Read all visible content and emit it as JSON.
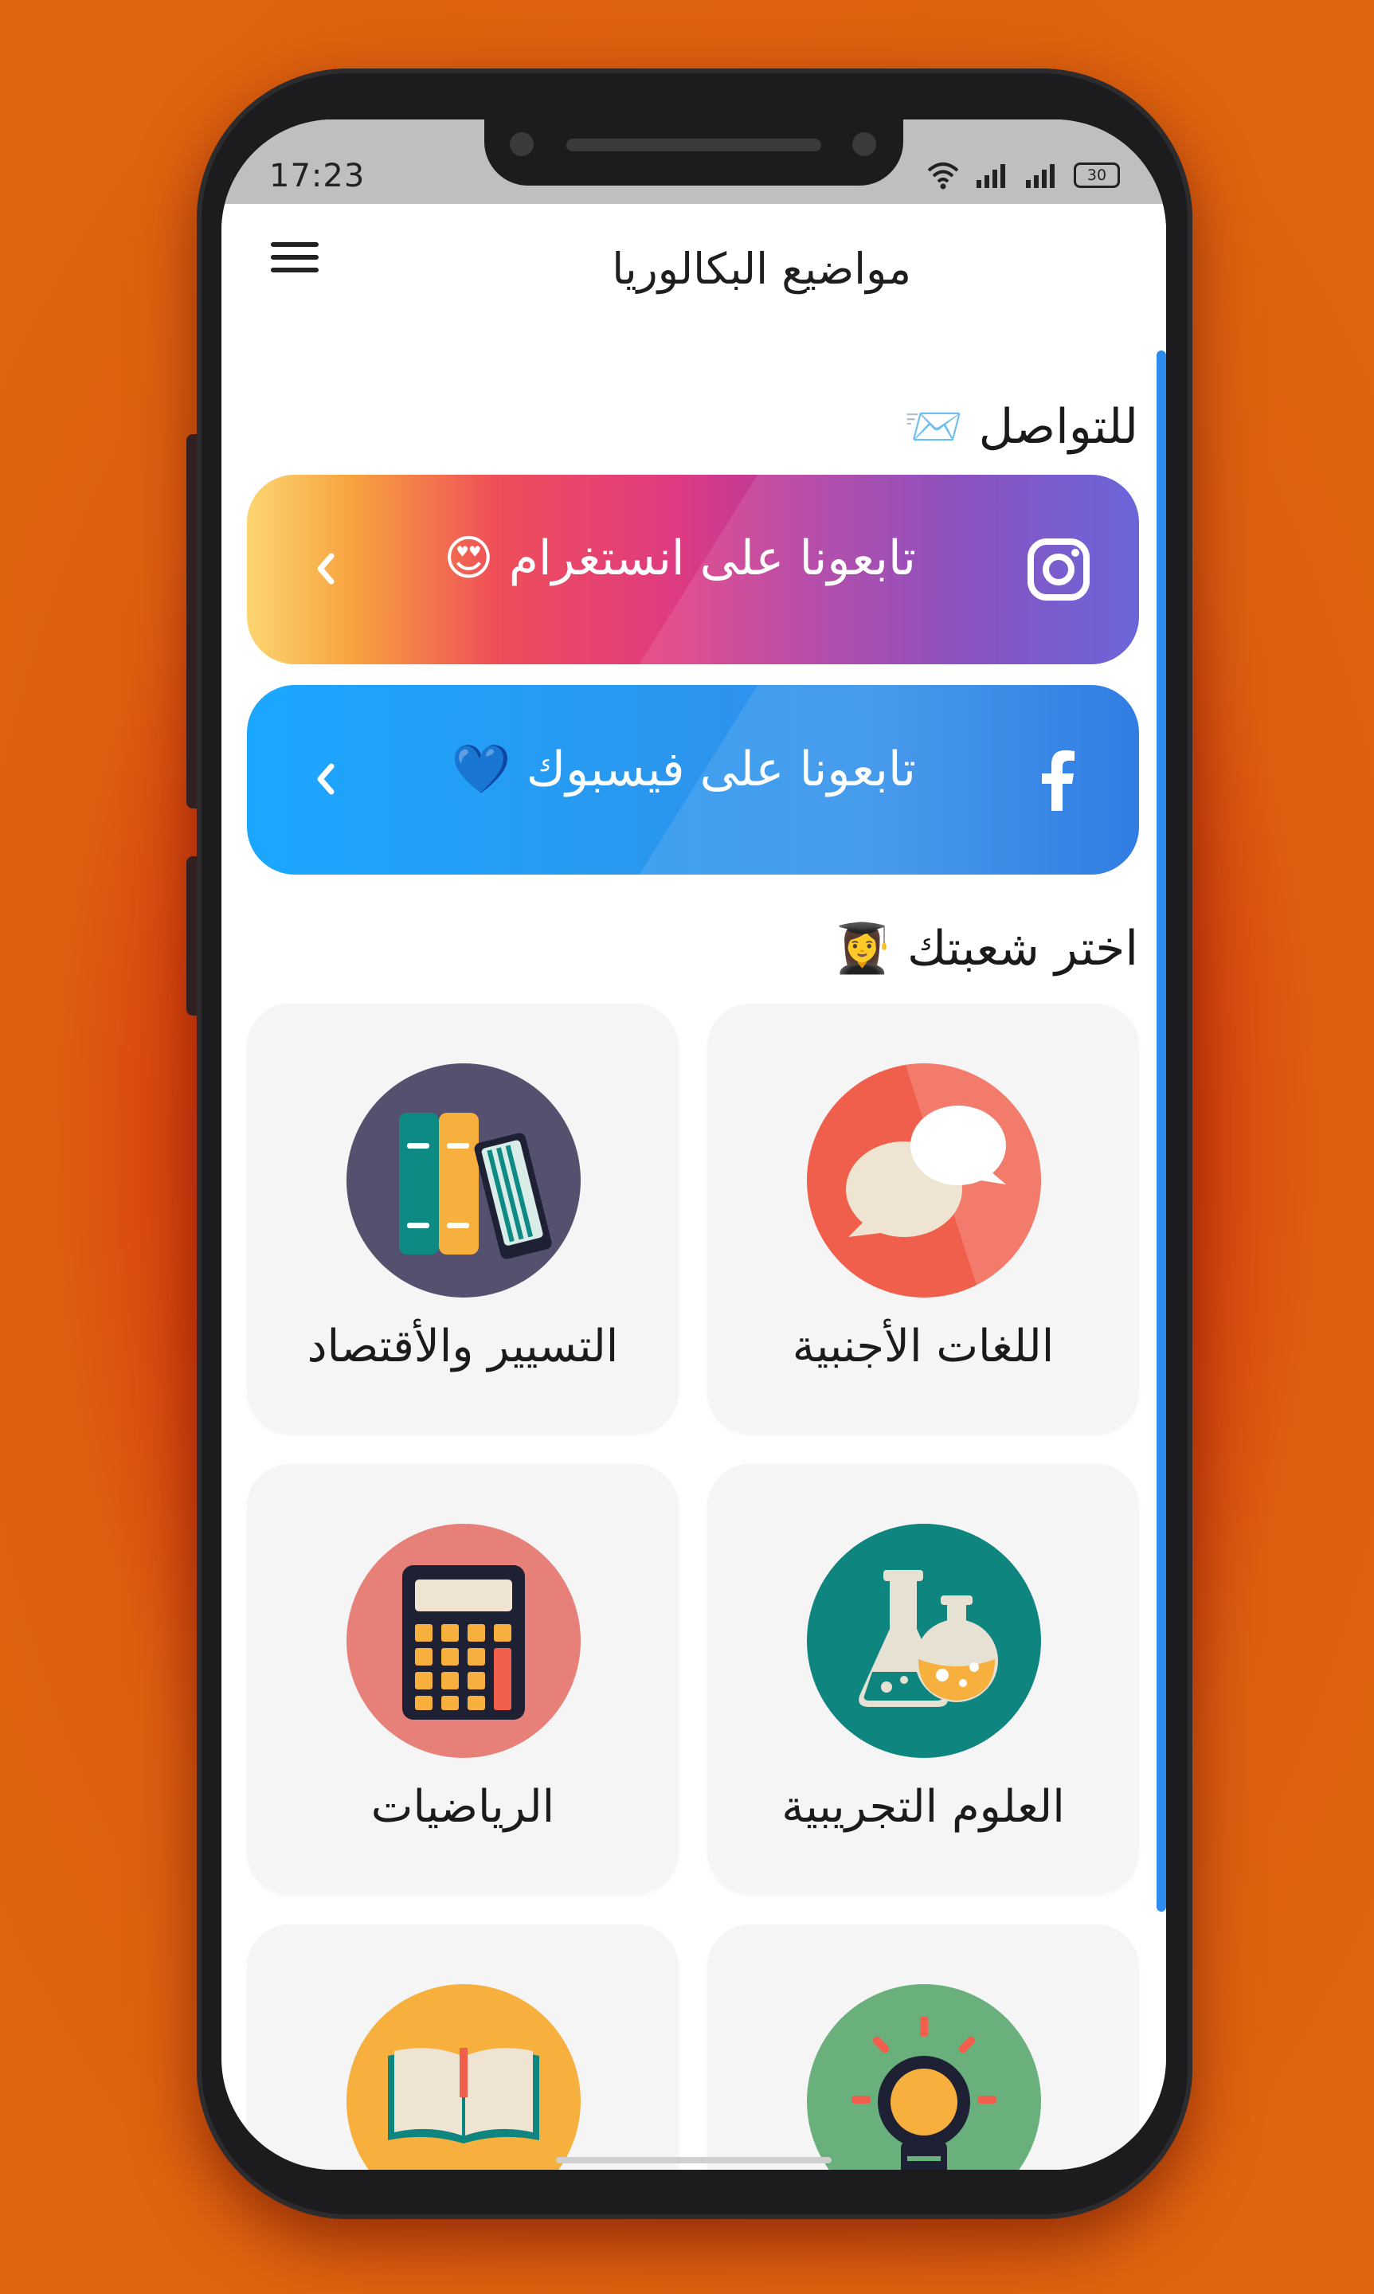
{
  "status_bar": {
    "time": "17:23",
    "battery": "30"
  },
  "toolbar": {
    "title": "مواضيع البكالوريا"
  },
  "contact_section": {
    "title": "للتواصل 📨"
  },
  "social": {
    "instagram_label": "تابعونا على انستغرام 😍",
    "facebook_label": "تابعونا على فيسبوك 💙"
  },
  "branch_section": {
    "title": "اختر شعبتك 👩‍🎓"
  },
  "cards": [
    {
      "label": "اللغات الأجنبية",
      "icon": "speech-bubbles-icon"
    },
    {
      "label": "التسيير والأقتصاد",
      "icon": "books-icon"
    },
    {
      "label": "العلوم التجريبية",
      "icon": "flasks-icon"
    },
    {
      "label": "الرياضيات",
      "icon": "calculator-icon"
    },
    {
      "label": "",
      "icon": "lightbulb-icon"
    },
    {
      "label": "",
      "icon": "open-book-icon"
    }
  ],
  "colors": {
    "background": "#e0650f",
    "accent_scroll": "#2d8cf0",
    "card_bg": "#f5f5f5",
    "languages_circle": "#ef5f4c",
    "economy_circle": "#55506e",
    "science_circle": "#0f8580",
    "math_circle": "#e8807a",
    "idea_circle": "#6ab07c",
    "literature_circle": "#f7b03d"
  }
}
